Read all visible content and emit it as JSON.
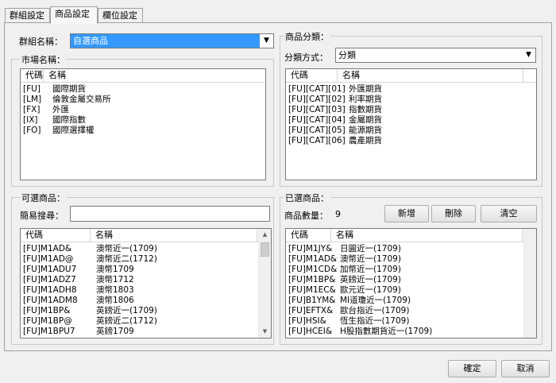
{
  "tabs": [
    {
      "label": "群組設定"
    },
    {
      "label": "商品設定"
    },
    {
      "label": "欄位設定"
    }
  ],
  "group_name": {
    "label": "群組名稱：",
    "value": "自選商品"
  },
  "market": {
    "label": "市場名稱：",
    "headers": {
      "code": "代碼",
      "name": "名稱"
    },
    "rows": [
      {
        "code": "[FU]",
        "name": "國際期貨"
      },
      {
        "code": "[LM]",
        "name": "倫敦金屬交易所"
      },
      {
        "code": "[FX]",
        "name": "外匯"
      },
      {
        "code": "[IX]",
        "name": "國際指數"
      },
      {
        "code": "[FO]",
        "name": "國際選擇權"
      }
    ]
  },
  "category": {
    "label": "商品分類：",
    "method_label": "分類方式：",
    "method_value": "分類",
    "headers": {
      "code": "代碼",
      "name": "名稱"
    },
    "rows": [
      {
        "code": "[FU][CAT][01]",
        "name": "外匯期貨"
      },
      {
        "code": "[FU][CAT][02]",
        "name": "利率期貨"
      },
      {
        "code": "[FU][CAT][03]",
        "name": "指數期貨"
      },
      {
        "code": "[FU][CAT][04]",
        "name": "金屬期貨"
      },
      {
        "code": "[FU][CAT][05]",
        "name": "能源期貨"
      },
      {
        "code": "[FU][CAT][06]",
        "name": "農產期貨"
      }
    ]
  },
  "available": {
    "label": "可選商品：",
    "search_label": "簡易搜尋：",
    "search_value": "",
    "headers": {
      "code": "代碼",
      "name": "名稱"
    },
    "rows": [
      {
        "code": "[FU]M1AD&",
        "name": "澳幣近一(1709)"
      },
      {
        "code": "[FU]M1AD@",
        "name": "澳幣近二(1712)"
      },
      {
        "code": "[FU]M1ADU7",
        "name": "澳幣1709"
      },
      {
        "code": "[FU]M1ADZ7",
        "name": "澳幣1712"
      },
      {
        "code": "[FU]M1ADH8",
        "name": "澳幣1803"
      },
      {
        "code": "[FU]M1ADM8",
        "name": "澳幣1806"
      },
      {
        "code": "[FU]M1BP&",
        "name": "英鎊近一(1709)"
      },
      {
        "code": "[FU]M1BP@",
        "name": "英鎊近二(1712)"
      },
      {
        "code": "[FU]M1BPU7",
        "name": "英鎊1709"
      }
    ]
  },
  "selected": {
    "label": "已選商品：",
    "count_label": "商品數量：",
    "count_value": "9",
    "add_label": "新增",
    "delete_label": "刪除",
    "clear_label": "清空",
    "headers": {
      "code": "代碼",
      "name": "名稱"
    },
    "rows": [
      {
        "code": "[FU]M1JY&",
        "name": "日圓近一(1709)"
      },
      {
        "code": "[FU]M1AD&",
        "name": "澳幣近一(1709)"
      },
      {
        "code": "[FU]M1CD&",
        "name": "加幣近一(1709)"
      },
      {
        "code": "[FU]M1BP&",
        "name": "英鎊近一(1709)"
      },
      {
        "code": "[FU]M1EC&",
        "name": "歐元近一(1709)"
      },
      {
        "code": "[FU]B1YM&",
        "name": "MI道瓊近一(1709)"
      },
      {
        "code": "[FU]EFTX&",
        "name": "歐台指近一(1709)"
      },
      {
        "code": "[FU]HSI&",
        "name": "恆生指近一(1709)"
      },
      {
        "code": "[FU]HCEI&",
        "name": "H股指數期貨近一(1709)"
      }
    ]
  },
  "footer": {
    "ok_label": "確定",
    "cancel_label": "取消"
  }
}
